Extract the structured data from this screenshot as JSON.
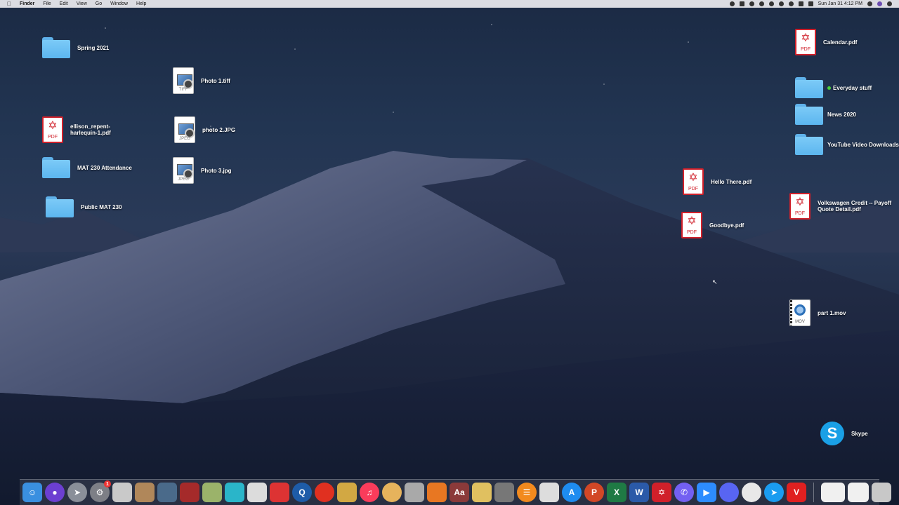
{
  "menubar": {
    "app_name": "Finder",
    "menus": [
      "File",
      "Edit",
      "View",
      "Go",
      "Window",
      "Help"
    ],
    "clock": "Sun Jan 31  4:12 PM"
  },
  "desktop_icons": {
    "spring_2021": "Spring 2021",
    "photo1": "Photo 1.tiff",
    "ellison": "ellison_repent-\nharlequin-1.pdf",
    "photo2": "photo 2.JPG",
    "mat230_attendance": "MAT 230 Attendance",
    "photo3": "Photo 3.jpg",
    "public_mat230": "Public MAT 230",
    "calendar": "Calendar.pdf",
    "everyday_stuff": "Everyday stuff",
    "news_2020": "News 2020",
    "youtube_downloads": "YouTube Video Downloads",
    "hello_there": "Hello There.pdf",
    "goodbye": "Goodbye.pdf",
    "volkswagen": "Volkswagen Credit -- Payoff\nQuote Detail.pdf",
    "part1_mov": "part 1.mov",
    "skype": "Skype"
  },
  "file_ext": {
    "pdf": "PDF",
    "tiff": "TIFF",
    "jpeg": "JPEG",
    "mov": "MOV"
  },
  "dock": {
    "badge_count": "1",
    "colors": {
      "finder": "#3a8fe0",
      "siri": "#6c3fd1",
      "launchpad": "#8a8f99",
      "prefs": "#7d7f86",
      "acrobat": "#d0202a",
      "word": "#2b5aa8",
      "excel": "#1f7a44",
      "powerpoint": "#d24726",
      "chrome": "#e8e8e8",
      "zoom": "#2d8cff",
      "discord": "#5865f2",
      "viber": "#7360f2",
      "appstore": "#1e8cf0",
      "safari": "#1a9cf0",
      "books": "#f28a1e",
      "music": "#fa3c5b"
    }
  }
}
